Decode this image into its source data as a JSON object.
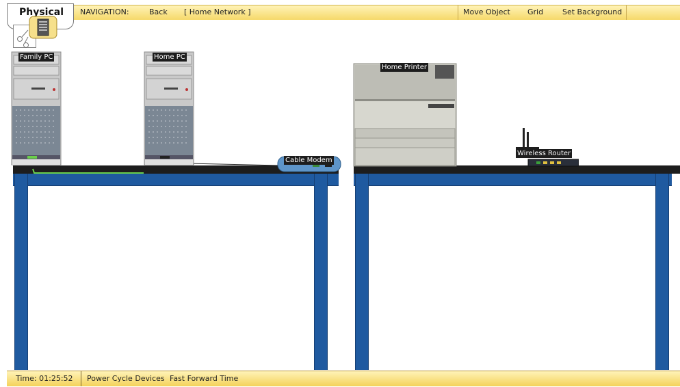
{
  "top_bar": {
    "mode_tab": "Physical",
    "navigation_label": "NAVIGATION:",
    "back_label": "Back",
    "location_label": "[ Home Network ]",
    "move_object_label": "Move Object",
    "grid_label": "Grid",
    "set_background_label": "Set Background"
  },
  "devices": {
    "family_pc": "Family PC",
    "home_pc": "Home PC",
    "cable_modem": "Cable Modem",
    "home_printer": "Home Printer",
    "wireless_router": "Wireless Router"
  },
  "bottom_bar": {
    "time_text": "Time: 01:25:52",
    "power_cycle_label": "Power Cycle Devices",
    "fast_forward_label": "Fast Forward Time"
  },
  "colors": {
    "toolbar": "#f6d96a",
    "table_blue": "#1f5aa0",
    "table_top": "#1d1d1d",
    "cable_green": "#6bd04b"
  },
  "icons": {
    "mode_icon": "physical-view-icon",
    "mode_icon_secondary": "cluster-icon"
  }
}
